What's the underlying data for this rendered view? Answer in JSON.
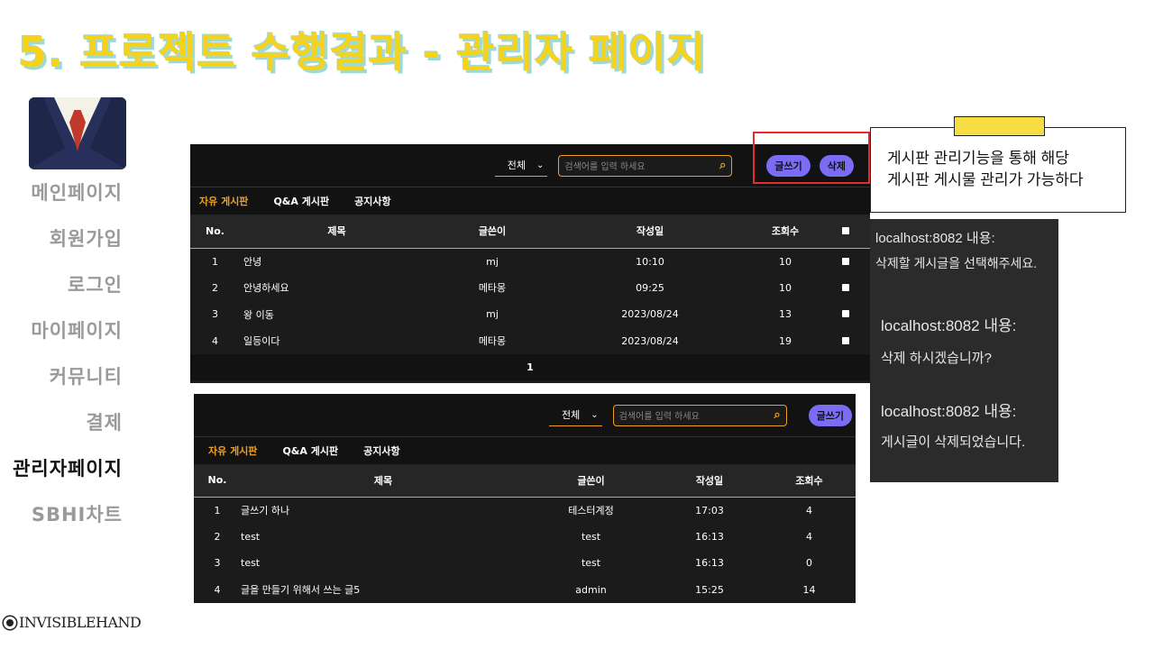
{
  "title": "5. 프로젝트 수행결과 - 관리자 페이지",
  "nav": {
    "items": [
      "메인페이지",
      "회원가입",
      "로그인",
      "마이페이지",
      "커뮤니티",
      "결제",
      "관리자페이지",
      "SBHI차트"
    ],
    "active_index": 6
  },
  "brand": "INVISIBLEHAND",
  "board1": {
    "select_value": "전체",
    "search_placeholder": "검색어를 입력 하세요",
    "write_label": "글쓰기",
    "delete_label": "삭제",
    "tabs": [
      "자유 게시판",
      "Q&A 게시판",
      "공지사항"
    ],
    "columns": [
      "No.",
      "제목",
      "글쓴이",
      "작성일",
      "조회수"
    ],
    "rows": [
      {
        "no": "1",
        "title": "안녕",
        "author": "mj",
        "date": "10:10",
        "views": "10"
      },
      {
        "no": "2",
        "title": "안녕하세요",
        "author": "메타몽",
        "date": "09:25",
        "views": "10"
      },
      {
        "no": "3",
        "title": "왕 이동",
        "author": "mj",
        "date": "2023/08/24",
        "views": "13"
      },
      {
        "no": "4",
        "title": "일등이다",
        "author": "메타몽",
        "date": "2023/08/24",
        "views": "19"
      }
    ],
    "page": "1"
  },
  "board2": {
    "select_value": "전체",
    "search_placeholder": "검색어를 입력 하세요",
    "write_label": "글쓰기",
    "tabs": [
      "자유 게시판",
      "Q&A 게시판",
      "공지사항"
    ],
    "columns": [
      "No.",
      "제목",
      "글쓴이",
      "작성일",
      "조회수"
    ],
    "rows": [
      {
        "no": "1",
        "title": "글쓰기 하나",
        "author": "테스터계정",
        "date": "17:03",
        "views": "4"
      },
      {
        "no": "2",
        "title": "test",
        "author": "test",
        "date": "16:13",
        "views": "4"
      },
      {
        "no": "3",
        "title": "test",
        "author": "test",
        "date": "16:13",
        "views": "0"
      },
      {
        "no": "4",
        "title": "글을 만들기 위해서 쓰는 글5",
        "author": "admin",
        "date": "15:25",
        "views": "14"
      }
    ]
  },
  "callout": {
    "line1": "게시판 관리기능을 통해 해당",
    "line2": "게시판 게시물 관리가 가능하다"
  },
  "dialogs": [
    {
      "host": "localhost:8082 내용:",
      "message": "삭제할 게시글을 선택해주세요."
    },
    {
      "host": "localhost:8082 내용:",
      "message": "삭제 하시겠습니까?"
    },
    {
      "host": "localhost:8082 내용:",
      "message": "게시글이 삭제되었습니다."
    }
  ],
  "colors": {
    "title": "#f6d21a",
    "accent": "#f0a020",
    "button": "#7b6cf6",
    "highlight": "#e52b2b"
  }
}
